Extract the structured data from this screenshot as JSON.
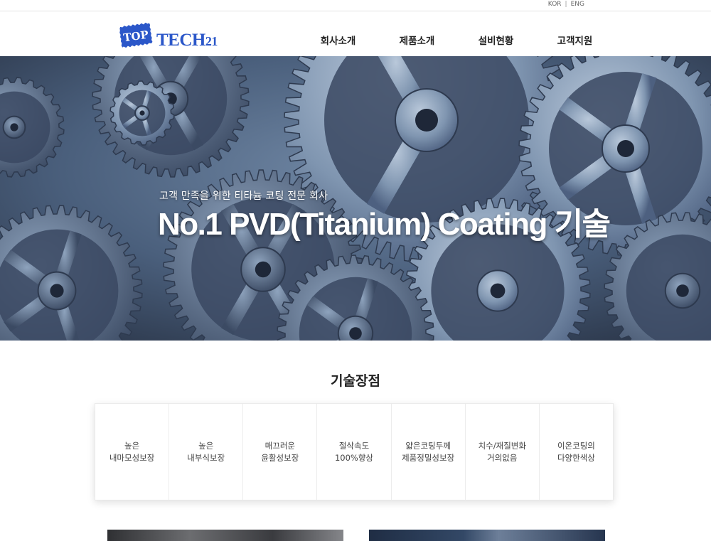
{
  "topbar": {
    "lang_kor": "KOR",
    "lang_sep": "|",
    "lang_eng": "ENG"
  },
  "header": {
    "logo": {
      "badge_text": "TOP",
      "wordmark": "TECH21"
    },
    "nav": [
      {
        "label": "회사소개"
      },
      {
        "label": "제품소개"
      },
      {
        "label": "설비현황"
      },
      {
        "label": "고객지원"
      }
    ]
  },
  "hero": {
    "subtitle": "고객 만족을 위한 티타늄 코팅 전문 회사",
    "title": "No.1 PVD(Titanium) Coating 기술"
  },
  "features": {
    "title": "기술장점",
    "items": [
      {
        "text": "높은\n내마모성보장"
      },
      {
        "text": "높은\n내부식보장"
      },
      {
        "text": "매끄러운\n윤활성보장"
      },
      {
        "text": "절삭속도\n100%향상"
      },
      {
        "text": "얇은코팅두께\n제품정밀성보장"
      },
      {
        "text": "치수/재질변화\n거의없음"
      },
      {
        "text": "이온코팅의\n다양한색상"
      }
    ]
  },
  "colors": {
    "logo_blue": "#2b57c9",
    "hero_steel": "#4b5f7a"
  }
}
